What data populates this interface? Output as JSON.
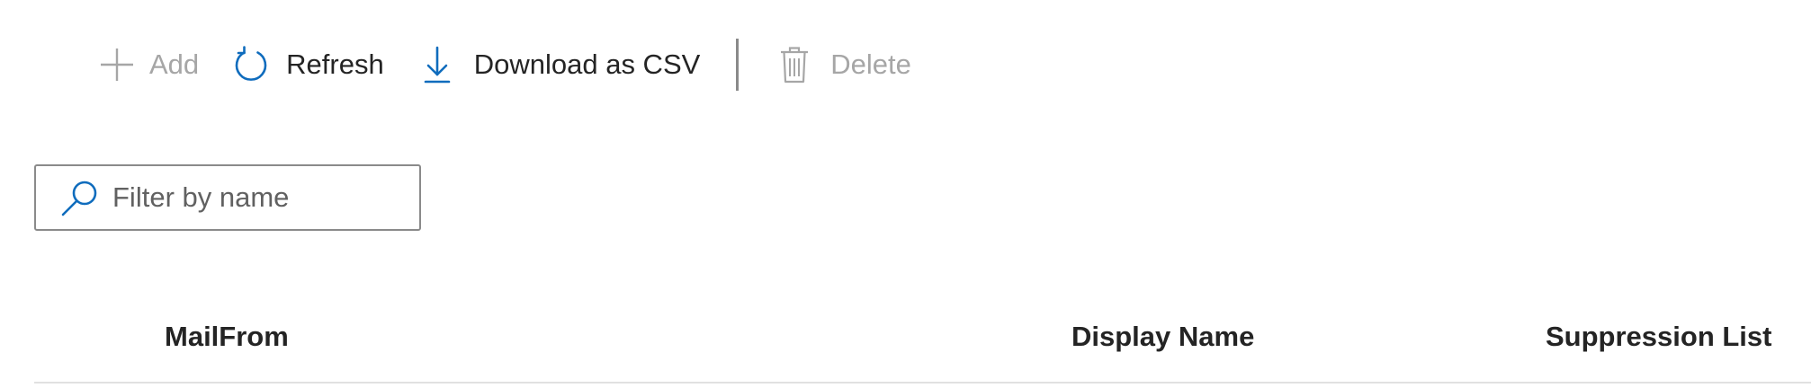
{
  "toolbar": {
    "add_label": "Add",
    "refresh_label": "Refresh",
    "download_label": "Download as CSV",
    "delete_label": "Delete"
  },
  "search": {
    "placeholder": "Filter by name",
    "value": ""
  },
  "table": {
    "columns": [
      "MailFrom",
      "Display Name",
      "Suppression List"
    ]
  },
  "colors": {
    "accent": "#0f6cbd",
    "disabled": "#a6a6a6",
    "text": "#242424"
  },
  "icons": {
    "add": "plus-icon",
    "refresh": "refresh-icon",
    "download": "download-icon",
    "delete": "trash-icon",
    "search": "search-icon"
  }
}
